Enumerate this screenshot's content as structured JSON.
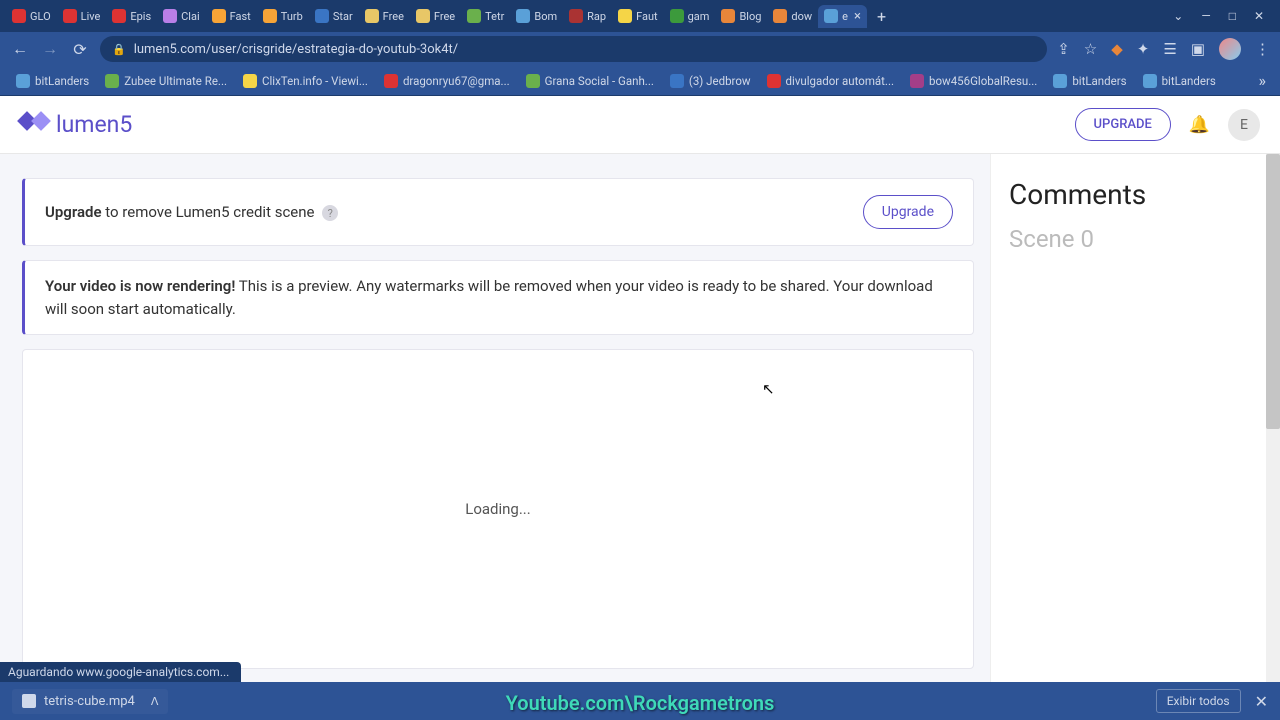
{
  "browser": {
    "tabs": [
      {
        "label": "GLO",
        "iconColor": "#d33"
      },
      {
        "label": "Live",
        "iconColor": "#d33"
      },
      {
        "label": "Epis",
        "iconColor": "#d33"
      },
      {
        "label": "Clai",
        "iconColor": "#b97fe8"
      },
      {
        "label": "Fast",
        "iconColor": "#f7a437"
      },
      {
        "label": "Turb",
        "iconColor": "#f7a437"
      },
      {
        "label": "Star",
        "iconColor": "#3a75c4"
      },
      {
        "label": "Free",
        "iconColor": "#e8c767"
      },
      {
        "label": "Free",
        "iconColor": "#e8c767"
      },
      {
        "label": "Tetr",
        "iconColor": "#6ab04c"
      },
      {
        "label": "Bom",
        "iconColor": "#5aa0d8"
      },
      {
        "label": "Rap",
        "iconColor": "#a33"
      },
      {
        "label": "Faut",
        "iconColor": "#f5d547"
      },
      {
        "label": "gam",
        "iconColor": "#3c9a3c"
      },
      {
        "label": "Blog",
        "iconColor": "#e8863a"
      },
      {
        "label": "dow",
        "iconColor": "#e8863a"
      },
      {
        "label": "e",
        "iconColor": "#5aa0d8",
        "active": true
      }
    ],
    "url": "lumen5.com/user/crisgride/estrategia-do-youtub-3ok4t/",
    "bookmarks": [
      {
        "label": "bitLanders",
        "iconColor": "#5aa0d8"
      },
      {
        "label": "Zubee Ultimate Re...",
        "iconColor": "#6ab04c"
      },
      {
        "label": "ClixTen.info - Viewi...",
        "iconColor": "#f5d547"
      },
      {
        "label": "dragonryu67@gma...",
        "iconColor": "#d33"
      },
      {
        "label": "Grana Social - Ganh...",
        "iconColor": "#6ab04c"
      },
      {
        "label": "(3) Jedbrow",
        "iconColor": "#3a75c4"
      },
      {
        "label": "divulgador automát...",
        "iconColor": "#d33"
      },
      {
        "label": "bow456GlobalResu...",
        "iconColor": "#a33e88"
      },
      {
        "label": "bitLanders",
        "iconColor": "#5aa0d8"
      },
      {
        "label": "bitLanders",
        "iconColor": "#5aa0d8"
      }
    ],
    "status": "Aguardando www.google-analytics.com...",
    "download": {
      "file": "tetris-cube.mp4",
      "showAll": "Exibir todos"
    }
  },
  "app": {
    "brand": "lumen5",
    "upgradeBtn": "UPGRADE",
    "avatarLetter": "E",
    "creditBanner": {
      "bold": "Upgrade",
      "rest": " to remove Lumen5 credit scene",
      "btn": "Upgrade"
    },
    "renderBanner": {
      "bold": "Your video is now rendering!",
      "rest": " This is a preview. Any watermarks will be removed when your video is ready to be shared. Your download will soon start automatically."
    },
    "loading": "Loading...",
    "comments": {
      "title": "Comments",
      "scene": "Scene 0"
    }
  },
  "watermark": "Youtube.com\\Rockgametrons"
}
